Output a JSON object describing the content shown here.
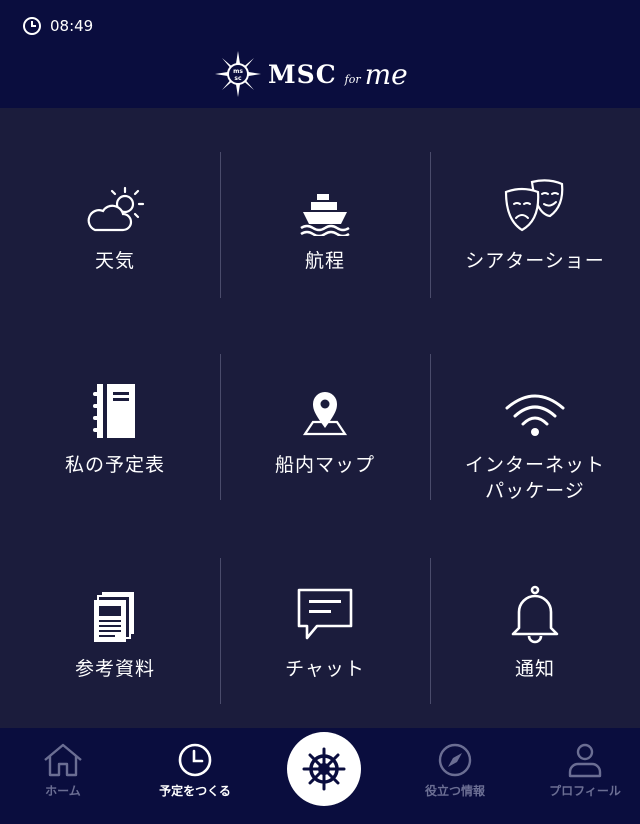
{
  "status": {
    "time": "08:49"
  },
  "header": {
    "brand": "MSC",
    "for": "for",
    "me": "me"
  },
  "tiles": [
    {
      "label": "天気",
      "icon": "weather-icon"
    },
    {
      "label": "航程",
      "icon": "ship-icon"
    },
    {
      "label": "シアターショー",
      "icon": "theater-masks-icon"
    },
    {
      "label": "私の予定表",
      "icon": "notebook-icon"
    },
    {
      "label": "船内マップ",
      "icon": "map-pin-icon"
    },
    {
      "label": "インターネット\nパッケージ",
      "icon": "wifi-icon"
    },
    {
      "label": "参考資料",
      "icon": "documents-icon"
    },
    {
      "label": "チャット",
      "icon": "chat-icon"
    },
    {
      "label": "通知",
      "icon": "bell-icon"
    }
  ],
  "nav": {
    "home": "ホーム",
    "schedule": "予定をつくる",
    "info": "役立つ情報",
    "profile": "プロフィール"
  },
  "colors": {
    "header_bg": "#0a0d3e",
    "grid_bg": "#1b1c3c",
    "nav_inactive": "#6b6e93"
  }
}
